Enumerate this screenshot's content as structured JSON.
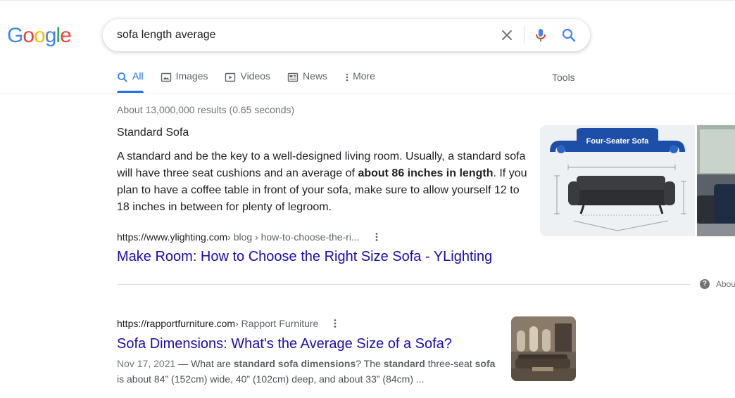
{
  "logo": {
    "letters": [
      "G",
      "o",
      "o",
      "g",
      "l",
      "e"
    ],
    "colors": [
      "#4285F4",
      "#EA4335",
      "#FBBC05",
      "#4285F4",
      "#34A853",
      "#EA4335"
    ]
  },
  "search": {
    "query": "sofa length average"
  },
  "tabs": [
    {
      "label": "All",
      "icon": "search-icon",
      "active": true
    },
    {
      "label": "Images",
      "icon": "image-icon",
      "active": false
    },
    {
      "label": "Videos",
      "icon": "video-icon",
      "active": false
    },
    {
      "label": "News",
      "icon": "news-icon",
      "active": false
    },
    {
      "label": "More",
      "icon": "more-vert-icon",
      "active": false
    }
  ],
  "tools_label": "Tools",
  "result_stats": "About 13,000,000 results (0.65 seconds)",
  "featured_snippet": {
    "heading": "Standard Sofa",
    "text_before": "A standard and be the key to a well-designed living room. Usually, a standard sofa will have three seat cushions and an average of ",
    "text_bold": "about 86 inches in length",
    "text_after": ". If you plan to have a coffee table in front of your sofa, make sure to allow yourself 12 to 18 inches in between for plenty of legroom.",
    "source_domain": "https://www.ylighting.com",
    "source_path": " › blog › how-to-choose-the-ri...",
    "title": "Make Room: How to Choose the Right Size Sofa - YLighting",
    "image_banner": "Four-Seater Sofa",
    "about_label": "About"
  },
  "result2": {
    "domain": "https://rapportfurniture.com",
    "path": " › Rapport Furniture",
    "title": "Sofa Dimensions: What's the Average Size of a Sofa?",
    "date": "Nov 17, 2021",
    "snippet_parts": [
      {
        "t": " — What are ",
        "b": false
      },
      {
        "t": "standard sofa dimensions",
        "b": true
      },
      {
        "t": "? The ",
        "b": false
      },
      {
        "t": "standard",
        "b": true
      },
      {
        "t": " three-seat ",
        "b": false
      },
      {
        "t": "sofa",
        "b": true
      },
      {
        "t": " is about 84” (152cm) wide, 40” (102cm) deep, and about 33” (84cm) ...",
        "b": false
      }
    ]
  },
  "colors": {
    "link": "#1a0dab",
    "accent": "#1a73e8"
  }
}
